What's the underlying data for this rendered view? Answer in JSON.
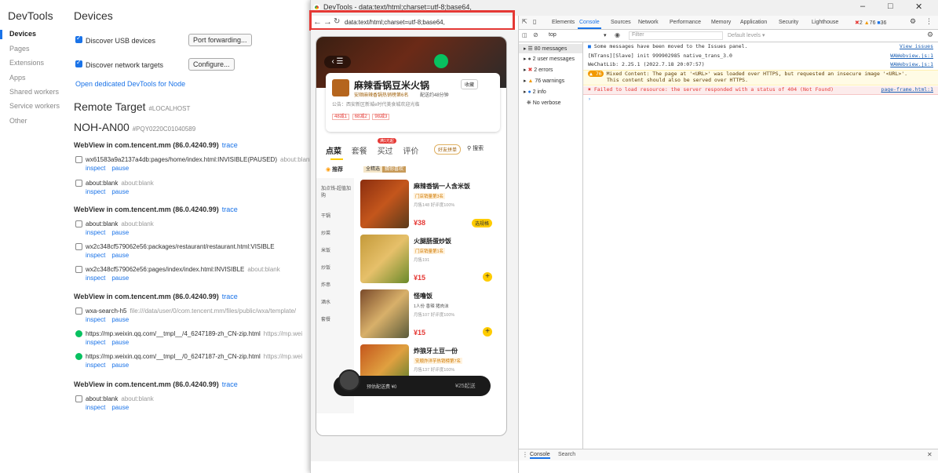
{
  "inspect": {
    "title": "DevTools",
    "nav": [
      "Devices",
      "Pages",
      "Extensions",
      "Apps",
      "Shared workers",
      "Service workers",
      "Other"
    ],
    "page_title": "Devices",
    "discover_usb": "Discover USB devices",
    "port_forwarding": "Port forwarding...",
    "discover_network": "Discover network targets",
    "configure": "Configure...",
    "open_dedicated": "Open dedicated DevTools for Node",
    "remote_target": "Remote Target",
    "localhost": "#LOCALHOST",
    "device": "NOH-AN00",
    "serial": "#PQY0220C01040589",
    "trace": "trace",
    "inspect_link": "inspect",
    "pause_link": "pause",
    "webviews": [
      {
        "header": "WebView in com.tencent.mm (86.0.4240.99)",
        "targets": [
          {
            "title": "wx61583a9a2137a4db:pages/home/index.html:INVISIBLE(PAUSED)",
            "url": "about:blank"
          },
          {
            "title": "about:blank",
            "url": "about:blank"
          }
        ]
      },
      {
        "header": "WebView in com.tencent.mm (86.0.4240.99)",
        "targets": [
          {
            "title": "about:blank",
            "url": "about:blank"
          },
          {
            "title": "wx2c348cf579062e56:packages/restaurant/restaurant.html:VISIBLE",
            "url": ""
          },
          {
            "title": "wx2c348cf579062e56:pages/index/index.html:INVISIBLE",
            "url": "about:blank"
          }
        ]
      },
      {
        "header": "WebView in com.tencent.mm (86.0.4240.99)",
        "targets": [
          {
            "title": "wxa-search-h5",
            "url": "file:///data/user/0/com.tencent.mm/files/public/wxa/template/"
          },
          {
            "title": "https://mp.weixin.qq.com/__tmpl__/4_6247189-zh_CN-zip.html",
            "url": "https://mp.wei"
          },
          {
            "title": "https://mp.weixin.qq.com/__tmpl__/0_6247187-zh_CN-zip.html",
            "url": "https://mp.wei"
          }
        ]
      },
      {
        "header": "WebView in com.tencent.mm (86.0.4240.99)",
        "targets": [
          {
            "title": "about:blank",
            "url": "about:blank"
          }
        ]
      }
    ]
  },
  "devtools": {
    "window_title": "DevTools - data:text/html;charset=utf-8;base64,",
    "url": "data:text/html;charset=utf-8;base64,",
    "tabs": [
      "Elements",
      "Console",
      "Sources",
      "Network",
      "Performance",
      "Memory",
      "Application",
      "Security",
      "Lighthouse"
    ],
    "active_tab": "Console",
    "badges": {
      "errors": "2",
      "warnings": "76",
      "info": "36"
    },
    "context": "top",
    "filter_placeholder": "Filter",
    "levels": "Default levels ▾",
    "sidebar": [
      "80 messages",
      "2 user messages",
      "2 errors",
      "76 warnings",
      "2 info",
      "No verbose"
    ],
    "logs": [
      {
        "text": "Some messages have been moved to the Issues panel.",
        "src": "View issues",
        "type": "issue"
      },
      {
        "text": "[NTrans][Slave] init 999902985 native_trans_3.0",
        "src": "WAWebview.js:1",
        "type": "log"
      },
      {
        "text": "WeChatLib: 2.25.1 (2022.7.18 20:07:57)",
        "src": "WAWebview.js:1",
        "type": "log"
      },
      {
        "count": "76",
        "text": "Mixed Content: The page at '<URL>' was loaded over HTTPS, but requested an insecure image '<URL>'.",
        "text2": "This content should also be served over HTTPS.",
        "src": "",
        "type": "warn"
      },
      {
        "text": "Failed to load resource: the server responded with a status of 404 (Not Found)",
        "src": "page-frame.html:1",
        "type": "error"
      }
    ],
    "drawer_tabs": [
      "Console",
      "Search"
    ]
  },
  "phone": {
    "shop_name": "麻辣香锅豆米火锅",
    "collect": "收藏",
    "rank": "安顺麻辣香锅热销榜第6名",
    "delivery": "配送约48分钟",
    "notice": "公告：西安新区新城e时代美食城欢迎光临",
    "coupons": [
      "48减1",
      "68减2",
      "98减3"
    ],
    "tabs": [
      "点菜",
      "套餐",
      "买过",
      "评价"
    ],
    "tab_badge": "满1元起",
    "group_buy": "好友拼单",
    "search": "搜索",
    "recommend": "推荐",
    "chips": [
      "全精选",
      "猜你喜欢"
    ],
    "categories": [
      "加点钱-超值加购",
      "干锅",
      "炒菜",
      "米饭",
      "炒饭",
      "炸串",
      "酒水",
      "套餐"
    ],
    "items": [
      {
        "name": "麻辣香锅一人含米饭",
        "tag": "门店销量第3名",
        "stats": "月售148  好评度100%",
        "price": "¥38",
        "action": "选规格"
      },
      {
        "name": "火腿肠蛋炒饭",
        "tag": "门店销量第1名",
        "stats": "月售191",
        "price": "¥15",
        "action": "+"
      },
      {
        "name": "怪噜饭",
        "tag": "1人份  香辣  猪肉沫",
        "stats": "月售107  好评度100%",
        "price": "¥15",
        "action": "+"
      },
      {
        "name": "炸狼牙土豆一份",
        "tag": "安顺炸洋芋热销榜第7名",
        "stats": "月售137  好评度100%",
        "price": "",
        "action": ""
      }
    ],
    "cart_text": "预估配送费 ¥0",
    "cart_min": "¥25起送"
  }
}
